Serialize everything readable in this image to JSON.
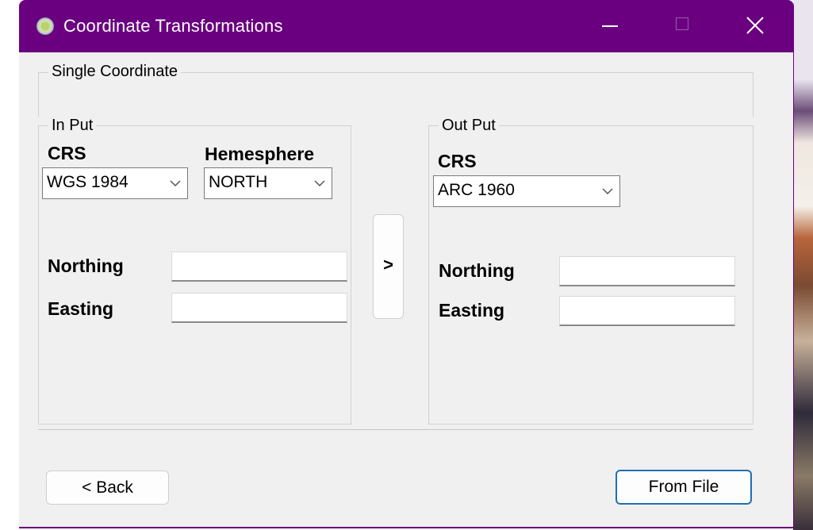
{
  "window": {
    "title": "Coordinate Transformations"
  },
  "single_coordinate": {
    "legend": "Single Coordinate"
  },
  "input": {
    "legend": "In Put",
    "crs_label": "CRS",
    "crs_value": "WGS 1984",
    "hemisphere_label": "Hemesphere",
    "hemisphere_value": "NORTH",
    "northing_label": "Northing",
    "northing_value": "",
    "easting_label": "Easting",
    "easting_value": ""
  },
  "transform_button": {
    "label": ">"
  },
  "output": {
    "legend": "Out Put",
    "crs_label": "CRS",
    "crs_value": "ARC 1960",
    "northing_label": "Northing",
    "northing_value": "",
    "easting_label": "Easting",
    "easting_value": ""
  },
  "footer": {
    "back_label": "< Back",
    "from_file_label": "From File"
  },
  "colors": {
    "titlebar": "#6a0080",
    "window_bg": "#f0f0f0",
    "focus_border": "#1f6fb5"
  }
}
